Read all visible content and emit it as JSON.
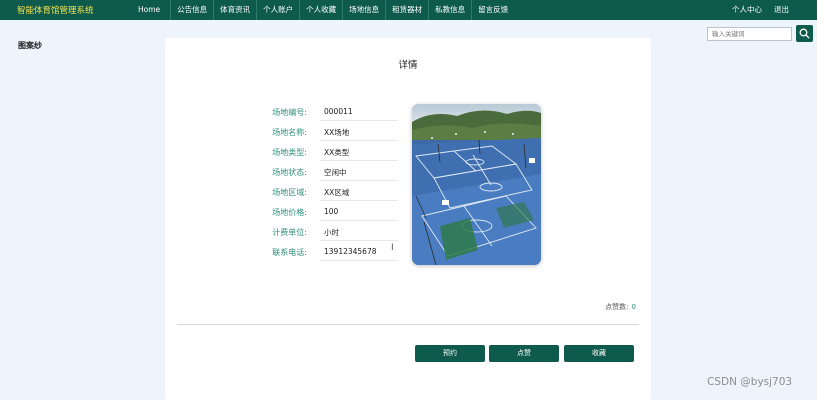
{
  "header": {
    "brand": "智能体育馆管理系统",
    "nav": [
      "Home",
      "公告信息",
      "体育资讯",
      "个人账户",
      "个人收藏",
      "场地信息",
      "租赁器材",
      "私教信息",
      "留言反馈"
    ],
    "right_links": [
      "个人中心",
      "退出"
    ]
  },
  "sidebar": {
    "label": "图案纱"
  },
  "search": {
    "placeholder": "输入关键词",
    "icon": "search-icon"
  },
  "detail": {
    "title": "详情",
    "fields": [
      {
        "label": "场地编号:",
        "value": "000011"
      },
      {
        "label": "场地名称:",
        "value": "XX场地"
      },
      {
        "label": "场地类型:",
        "value": "XX类型"
      },
      {
        "label": "场地状态:",
        "value": "空闲中"
      },
      {
        "label": "场地区域:",
        "value": "XX区域"
      },
      {
        "label": "场地价格:",
        "value": "100"
      },
      {
        "label": "计费单位:",
        "value": "小时"
      },
      {
        "label": "联系电话:",
        "value": "13912345678"
      }
    ],
    "image": "basketball-court-photo",
    "likes_label": "点赞数:",
    "likes_count": "0",
    "buttons": [
      "预约",
      "点赞",
      "收藏"
    ]
  },
  "watermark": "CSDN @bysj703",
  "colors": {
    "primary": "#0e5a4c",
    "accent": "#2d8f7a",
    "brand_text": "#f2e14a",
    "page_bg": "#eef4fb"
  }
}
